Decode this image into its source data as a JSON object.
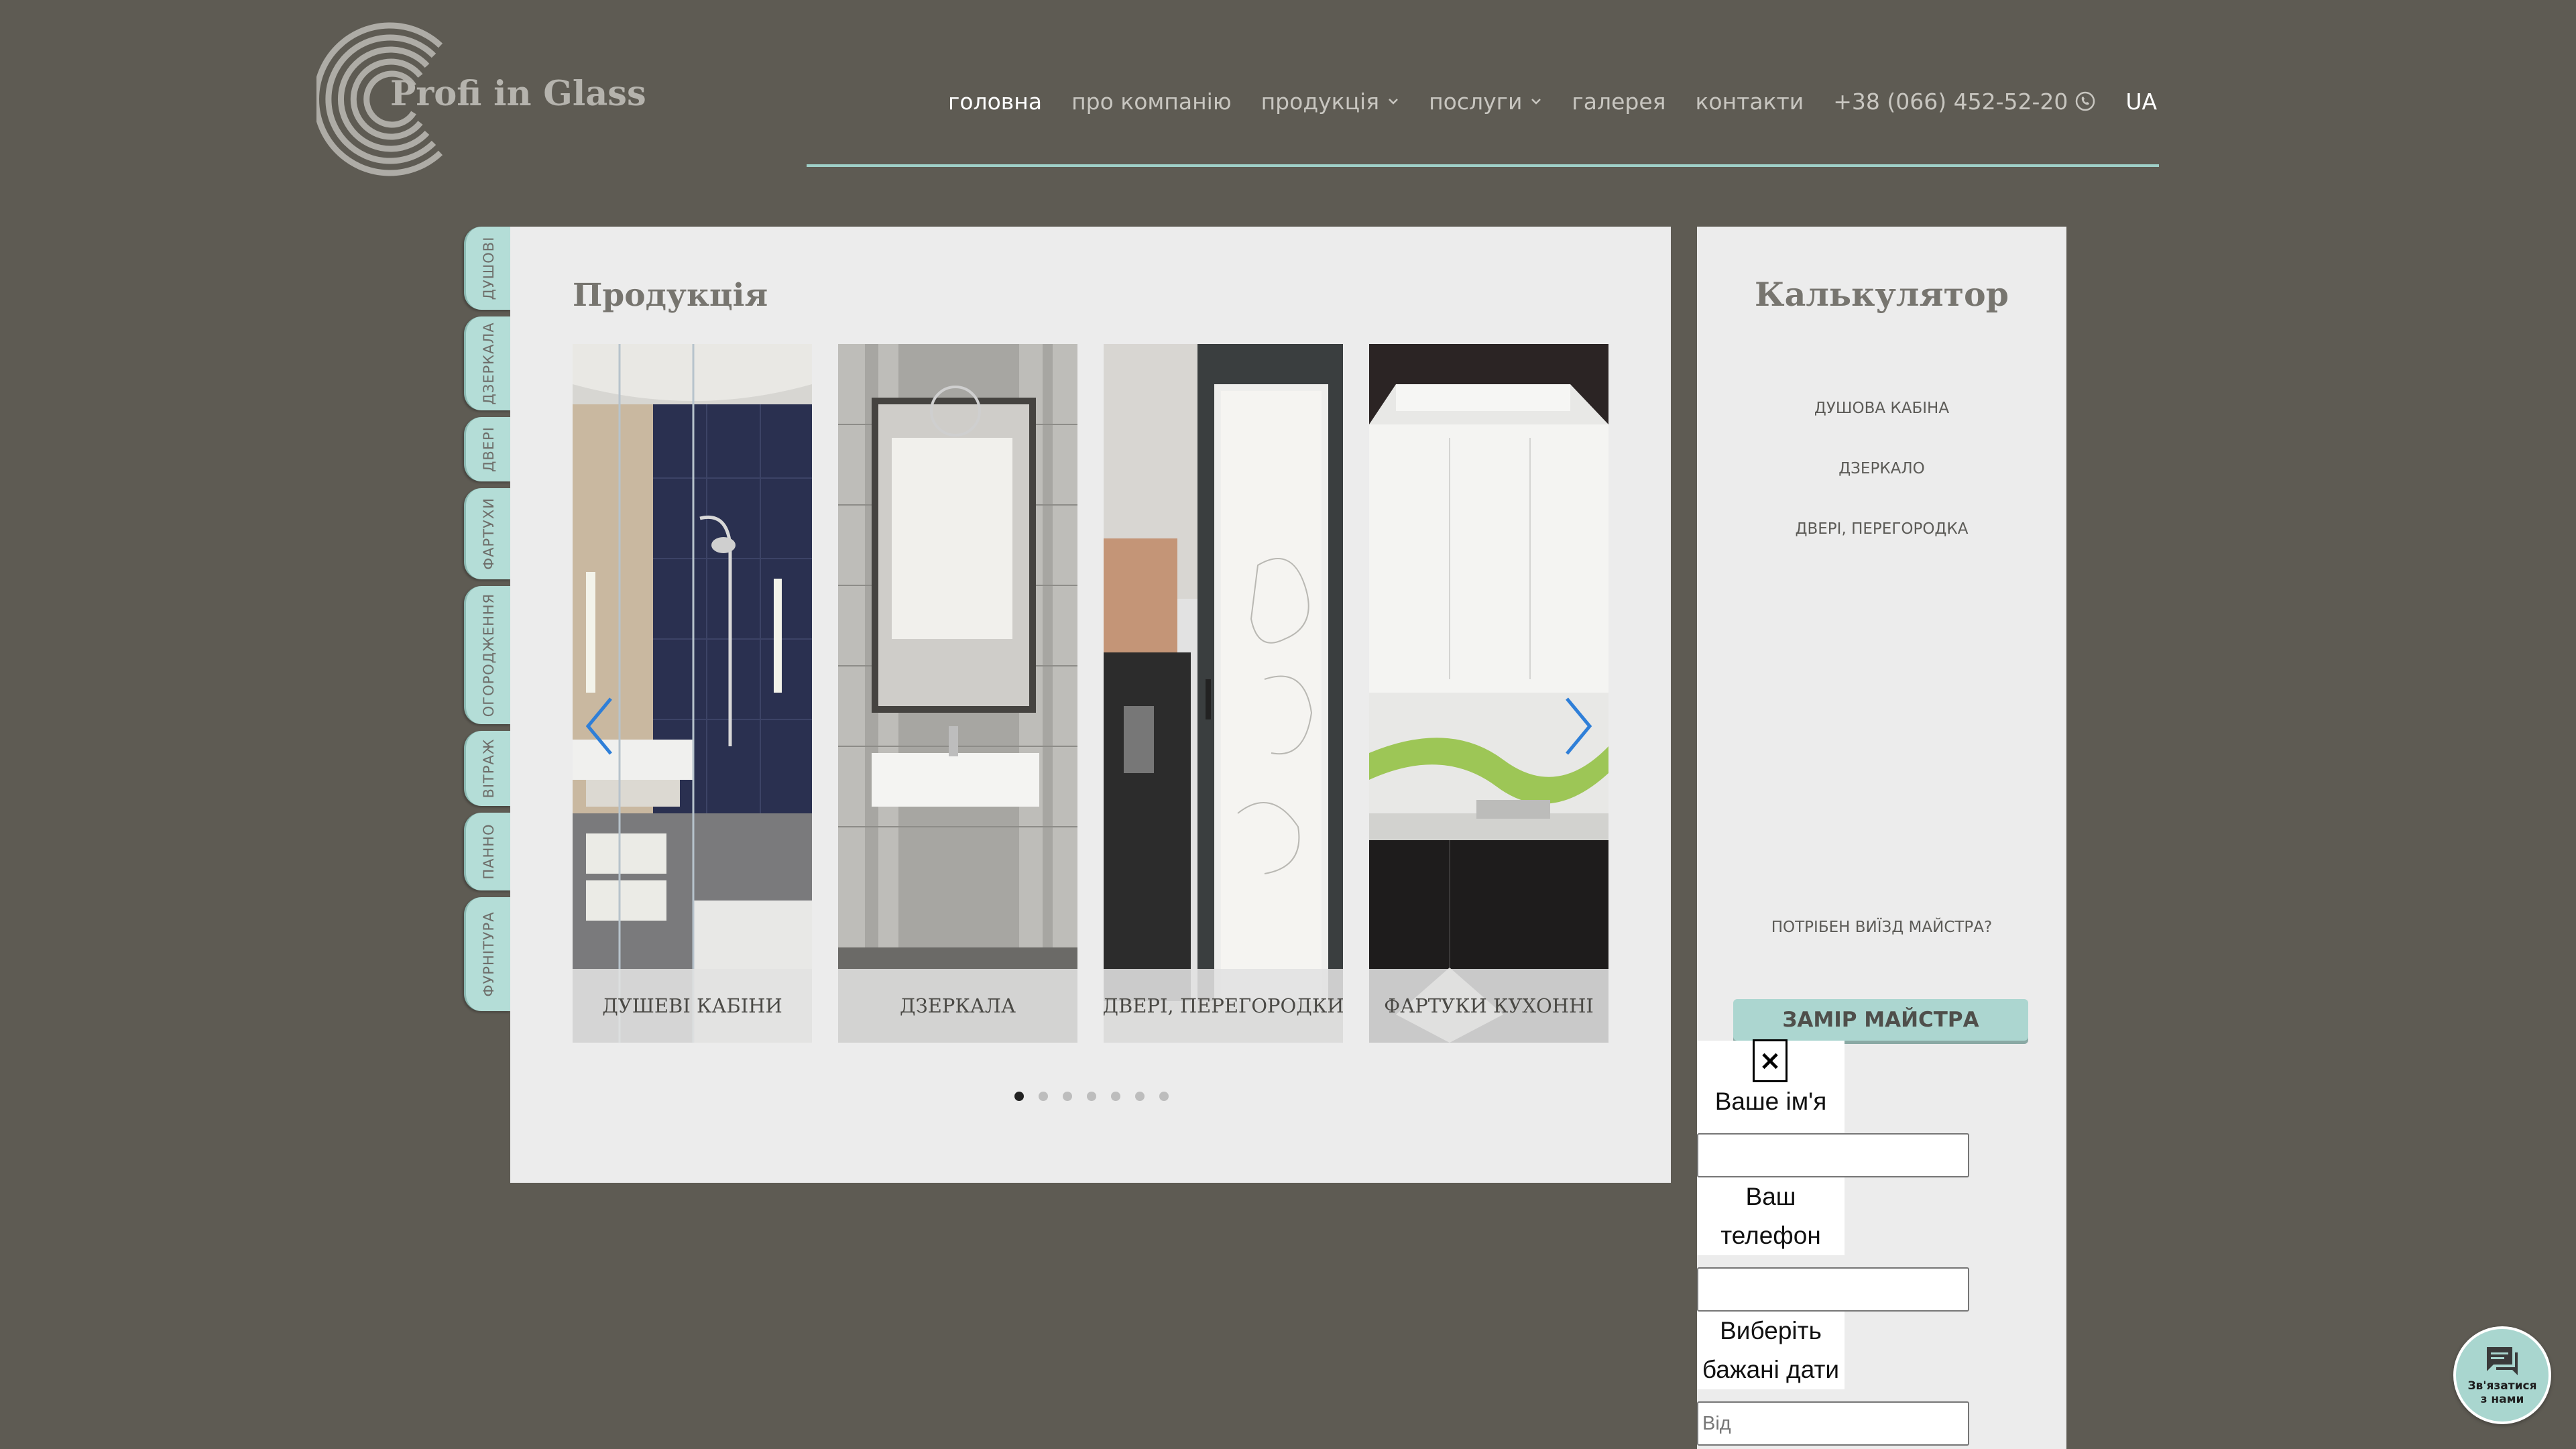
{
  "header": {
    "logo_text": "Profi in Glass",
    "nav": [
      {
        "label": "головна",
        "active": true
      },
      {
        "label": "про компанію"
      },
      {
        "label": "продукція",
        "dropdown": true
      },
      {
        "label": "послуги",
        "dropdown": true
      },
      {
        "label": "галерея"
      },
      {
        "label": "контакти"
      }
    ],
    "phone": "+38 (066) 452-52-20",
    "phone_icon": "viber-icon",
    "lang": "UA"
  },
  "side_tabs": [
    "ДУШОВІ",
    "ДЗЕРКАЛА",
    "ДВЕРІ",
    "ФАРТУХИ",
    "ОГОРОДЖЕННЯ",
    "ВІТРАЖ",
    "ПАННО",
    "ФУРНІТУРА"
  ],
  "products": {
    "title": "Продукція",
    "cards": [
      {
        "caption": "ДУШЕВІ КАБІНИ"
      },
      {
        "caption": "ДЗЕРКАЛА"
      },
      {
        "caption": "ДВЕРІ, ПЕРЕГОРОДКИ"
      },
      {
        "caption": "ФАРТУКИ КУХОННІ"
      }
    ],
    "slider_pages": 7,
    "active_page": 1
  },
  "calculator": {
    "title": "Калькулятор",
    "links": [
      "ДУШОВА КАБІНА",
      "ДЗЕРКАЛО",
      "ДВЕРІ, ПЕРЕГОРОДКА"
    ],
    "question": "ПОТРІБЕН ВИЇЗД МАЙСТРА?",
    "button": "ЗАМІР МАЙСТРА"
  },
  "form": {
    "close": "×",
    "name_label": "Ваше ім'я",
    "phone_label_1": "Ваш",
    "phone_label_2": "телефон",
    "date_label_1": "Виберіть",
    "date_label_2": "бажані дати",
    "date_from_placeholder": "Від"
  },
  "chat": {
    "label": "Зв'язатися з нами",
    "icon": "chat-icon"
  },
  "colors": {
    "background": "#5e5b53",
    "accent": "#acd6d0",
    "panel": "#ececec"
  }
}
